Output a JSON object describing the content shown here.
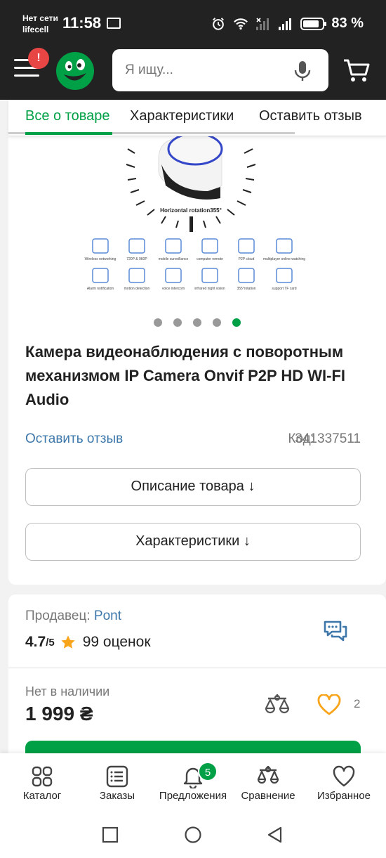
{
  "status_bar": {
    "carrier_line1": "Нет сети",
    "carrier_line2": "lifecell",
    "time": "11:58",
    "battery_percent": "83 %",
    "battery_level": 0.83
  },
  "header": {
    "notification_badge": "!",
    "search_placeholder": "Я ищу..."
  },
  "tabs": [
    {
      "label": "Все о товаре",
      "active": true
    },
    {
      "label": "Характеристики",
      "active": false
    },
    {
      "label": "Оставить отзыв",
      "active": false
    }
  ],
  "gallery": {
    "image_texts": {
      "rotation": "Horizontal rotation355°",
      "features": [
        "Wireless networking",
        "720P & 960P",
        "mobile surveillance",
        "computer remote",
        "P2P cloud",
        "multiplayer online watching",
        "Alarm notification",
        "motion detection",
        "voice intercom",
        "infrared night vision",
        "355°rotation",
        "support TF card"
      ]
    },
    "dots_total": 5,
    "active_dot": 5
  },
  "product": {
    "title": "Камера видеонаблюдения с поворотным механизмом IP Camera Onvif P2P HD WI-FI Audio",
    "review_link": "Оставить отзыв",
    "code_label": "Код:",
    "code_value": "341337511",
    "description_button": "Описание товара ↓",
    "specs_button": "Характеристики ↓"
  },
  "seller": {
    "label": "Продавец:",
    "name": "Pont",
    "rating": "4.7",
    "rating_max": "/5",
    "reviews": "99 оценок",
    "stock_status": "Нет в наличии",
    "price": "1 999 ₴",
    "favorites_count": "2"
  },
  "bottom_nav": [
    {
      "label": "Каталог",
      "icon": "catalog-icon"
    },
    {
      "label": "Заказы",
      "icon": "orders-icon"
    },
    {
      "label": "Предложения",
      "icon": "bell-icon",
      "badge": "5"
    },
    {
      "label": "Сравнение",
      "icon": "compare-icon"
    },
    {
      "label": "Избранное",
      "icon": "heart-icon"
    }
  ],
  "colors": {
    "accent_green": "#00a046",
    "link_blue": "#3e77aa",
    "header_dark": "#222222",
    "favorite_orange": "#f8a51c"
  }
}
